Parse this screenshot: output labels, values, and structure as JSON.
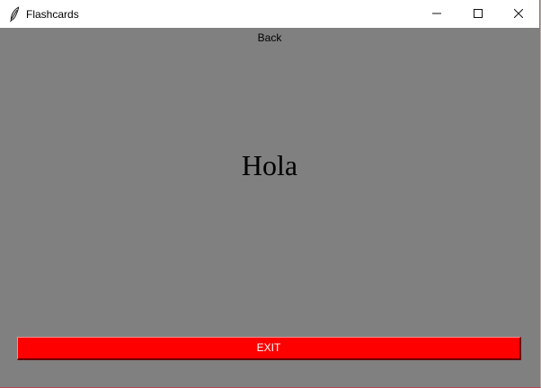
{
  "window": {
    "title": "Flashcards",
    "app_icon": "feather-icon",
    "controls": {
      "minimize_icon": "minimize-icon",
      "maximize_icon": "maximize-icon",
      "close_icon": "close-icon"
    }
  },
  "card": {
    "side_label": "Back",
    "word": "Hola"
  },
  "exit_button": {
    "label": "EXIT"
  },
  "colors": {
    "background": "#808080",
    "exit_button": "#ff0000",
    "exit_text": "#ffffff",
    "titlebar": "#ffffff"
  }
}
